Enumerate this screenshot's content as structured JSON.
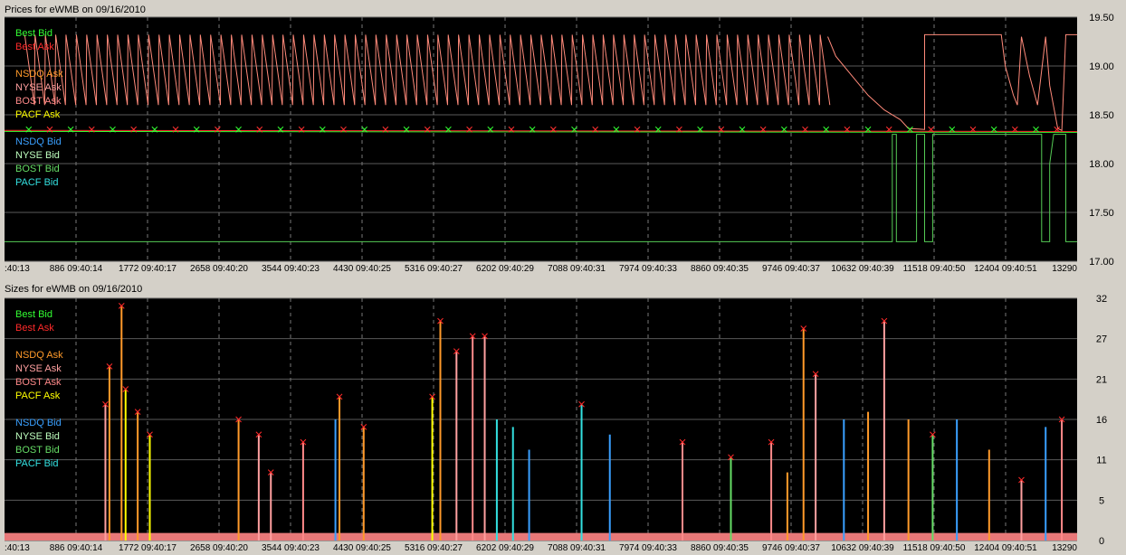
{
  "chart_data": [
    {
      "type": "line",
      "title": "Prices for  eWMB  on  09/16/2010",
      "ylim": [
        17.0,
        19.5
      ],
      "y_ticks": [
        "19.50",
        "19.00",
        "18.50",
        "18.00",
        "17.50",
        "17.00"
      ],
      "x_ticks": [
        ":40:13",
        "886 09:40:14",
        "1772 09:40:17",
        "2658 09:40:20",
        "3544 09:40:23",
        "4430 09:40:25",
        "5316 09:40:27",
        "6202 09:40:29",
        "7088 09:40:31",
        "7974 09:40:33",
        "8860 09:40:35",
        "9746 09:40:37",
        "10632 09:40:39",
        "11518 09:40:50",
        "12404 09:40:51",
        "13290"
      ],
      "x_range": [
        0,
        13290
      ],
      "grid": true,
      "legend": [
        {
          "label": "Best Bid",
          "color": "#33ff33"
        },
        {
          "label": "Best Ask",
          "color": "#ff2a2a"
        },
        {
          "label": "",
          "color": ""
        },
        {
          "label": "NSDQ Ask",
          "color": "#ff9a2a"
        },
        {
          "label": "NYSE Ask",
          "color": "#ffa0a0"
        },
        {
          "label": "BOST Ask",
          "color": "#ff8a8a"
        },
        {
          "label": "PACF Ask",
          "color": "#ffff00"
        },
        {
          "label": "",
          "color": ""
        },
        {
          "label": "NSDQ Bid",
          "color": "#3aa0ff"
        },
        {
          "label": "NYSE Bid",
          "color": "#bfffbf"
        },
        {
          "label": "BOST Bid",
          "color": "#66dd66"
        },
        {
          "label": "PACF Bid",
          "color": "#33e0e0"
        }
      ],
      "series": [
        {
          "name": "Best Bid",
          "color": "#33ff33",
          "values": [
            [
              0,
              18.33
            ],
            [
              13290,
              18.32
            ]
          ]
        },
        {
          "name": "Best Ask",
          "color": "#ff2a2a",
          "values": [
            [
              0,
              18.34
            ],
            [
              13290,
              18.33
            ]
          ]
        },
        {
          "name": "NYSE Ask",
          "color": "#ff8a7a",
          "sawtooth": {
            "x_start": 250,
            "x_end": 10200,
            "period": 128,
            "high": 19.32,
            "low": 18.6
          }
        },
        {
          "name": "NYSE Ask",
          "color": "#ff8a7a",
          "values": [
            [
              10200,
              19.3
            ],
            [
              10300,
              19.1
            ],
            [
              10500,
              18.9
            ],
            [
              10700,
              18.7
            ],
            [
              10900,
              18.55
            ],
            [
              11100,
              18.45
            ],
            [
              11200,
              18.36
            ],
            [
              11400,
              18.35
            ],
            [
              11400,
              19.32
            ],
            [
              12350,
              19.32
            ],
            [
              12400,
              19.0
            ],
            [
              12500,
              18.7
            ],
            [
              12550,
              18.6
            ],
            [
              12600,
              19.3
            ],
            [
              12700,
              18.9
            ],
            [
              12800,
              18.6
            ],
            [
              12900,
              19.3
            ],
            [
              12950,
              18.8
            ],
            [
              13050,
              18.36
            ],
            [
              13100,
              18.34
            ],
            [
              13150,
              19.32
            ],
            [
              13290,
              19.32
            ]
          ]
        },
        {
          "name": "BOST Bid",
          "color": "#55cc55",
          "values": [
            [
              0,
              17.2
            ],
            [
              11000,
              17.2
            ],
            [
              11000,
              18.3
            ],
            [
              11050,
              18.3
            ],
            [
              11050,
              17.2
            ],
            [
              11300,
              17.2
            ],
            [
              11300,
              18.3
            ],
            [
              11400,
              18.3
            ],
            [
              11400,
              17.2
            ],
            [
              11500,
              17.2
            ],
            [
              11500,
              18.3
            ],
            [
              12850,
              18.3
            ],
            [
              12850,
              17.2
            ],
            [
              12950,
              17.2
            ],
            [
              12950,
              18.0
            ],
            [
              13000,
              18.3
            ],
            [
              13150,
              18.3
            ],
            [
              13150,
              17.2
            ],
            [
              13290,
              17.2
            ]
          ]
        }
      ]
    },
    {
      "type": "bar",
      "title": "Sizes for  eWMB  on  09/16/2010",
      "ylim": [
        0,
        32
      ],
      "y_ticks": [
        "32",
        "27",
        "21",
        "16",
        "11",
        "5",
        "0"
      ],
      "x_ticks": [
        ":40:13",
        "886 09:40:14",
        "1772 09:40:17",
        "2658 09:40:20",
        "3544 09:40:23",
        "4430 09:40:25",
        "5316 09:40:27",
        "6202 09:40:29",
        "7088 09:40:31",
        "7974 09:40:33",
        "8860 09:40:35",
        "9746 09:40:37",
        "10632 09:40:39",
        "11518 09:40:50",
        "12404 09:40:51",
        "13290"
      ],
      "x_range": [
        0,
        13290
      ],
      "grid": true,
      "legend": [
        {
          "label": "Best Bid",
          "color": "#33ff33"
        },
        {
          "label": "Best Ask",
          "color": "#ff2a2a"
        },
        {
          "label": "",
          "color": ""
        },
        {
          "label": "NSDQ Ask",
          "color": "#ff9a2a"
        },
        {
          "label": "NYSE Ask",
          "color": "#ffa0a0"
        },
        {
          "label": "BOST Ask",
          "color": "#ff8a8a"
        },
        {
          "label": "PACF Ask",
          "color": "#ffff00"
        },
        {
          "label": "",
          "color": ""
        },
        {
          "label": "NSDQ Bid",
          "color": "#3aa0ff"
        },
        {
          "label": "NYSE Bid",
          "color": "#bfffbf"
        },
        {
          "label": "BOST Bid",
          "color": "#66dd66"
        },
        {
          "label": "PACF Bid",
          "color": "#33e0e0"
        }
      ],
      "baseline_band": {
        "value": 1,
        "color": "#e87878"
      },
      "spikes": [
        {
          "x": 1250,
          "y": 18,
          "color": "#ffa0a0",
          "marker": "x"
        },
        {
          "x": 1300,
          "y": 23,
          "color": "#ff9a2a",
          "marker": "x"
        },
        {
          "x": 1450,
          "y": 31,
          "color": "#ff9a2a",
          "marker": "x"
        },
        {
          "x": 1500,
          "y": 20,
          "color": "#ffff00",
          "marker": "x"
        },
        {
          "x": 1650,
          "y": 17,
          "color": "#ff9a2a",
          "marker": "x"
        },
        {
          "x": 1800,
          "y": 14,
          "color": "#ffff00",
          "marker": "x"
        },
        {
          "x": 2900,
          "y": 16,
          "color": "#ff9a2a",
          "marker": "x"
        },
        {
          "x": 3150,
          "y": 14,
          "color": "#ffa0a0",
          "marker": "x"
        },
        {
          "x": 3300,
          "y": 9,
          "color": "#ffa0a0",
          "marker": "x"
        },
        {
          "x": 3700,
          "y": 13,
          "color": "#ff8a8a",
          "marker": "x"
        },
        {
          "x": 4100,
          "y": 16,
          "color": "#3aa0ff",
          "marker": ""
        },
        {
          "x": 4150,
          "y": 19,
          "color": "#ff9a2a",
          "marker": "x"
        },
        {
          "x": 4450,
          "y": 15,
          "color": "#ff9a2a",
          "marker": "x"
        },
        {
          "x": 5300,
          "y": 19,
          "color": "#ffff00",
          "marker": "x"
        },
        {
          "x": 5400,
          "y": 29,
          "color": "#ff9a2a",
          "marker": "x"
        },
        {
          "x": 5600,
          "y": 25,
          "color": "#ffa0a0",
          "marker": "x"
        },
        {
          "x": 5800,
          "y": 27,
          "color": "#ff8a8a",
          "marker": "x"
        },
        {
          "x": 5950,
          "y": 27,
          "color": "#ffa0a0",
          "marker": "x"
        },
        {
          "x": 6100,
          "y": 16,
          "color": "#33e0e0",
          "marker": ""
        },
        {
          "x": 6300,
          "y": 15,
          "color": "#33e0e0",
          "marker": ""
        },
        {
          "x": 6500,
          "y": 12,
          "color": "#3aa0ff",
          "marker": ""
        },
        {
          "x": 7150,
          "y": 18,
          "color": "#33e0e0",
          "marker": "x"
        },
        {
          "x": 7500,
          "y": 14,
          "color": "#3aa0ff",
          "marker": ""
        },
        {
          "x": 8400,
          "y": 13,
          "color": "#ff8a8a",
          "marker": "x"
        },
        {
          "x": 9000,
          "y": 11,
          "color": "#66dd66",
          "marker": "x"
        },
        {
          "x": 9500,
          "y": 13,
          "color": "#ff8a8a",
          "marker": "x"
        },
        {
          "x": 9700,
          "y": 9,
          "color": "#ff9a2a",
          "marker": ""
        },
        {
          "x": 9900,
          "y": 28,
          "color": "#ff9a2a",
          "marker": "x"
        },
        {
          "x": 10050,
          "y": 22,
          "color": "#ffa0a0",
          "marker": "x"
        },
        {
          "x": 10400,
          "y": 16,
          "color": "#3aa0ff",
          "marker": ""
        },
        {
          "x": 10700,
          "y": 17,
          "color": "#ff9a2a",
          "marker": ""
        },
        {
          "x": 10900,
          "y": 29,
          "color": "#ffa0a0",
          "marker": "x"
        },
        {
          "x": 11200,
          "y": 16,
          "color": "#ff9a2a",
          "marker": ""
        },
        {
          "x": 11500,
          "y": 14,
          "color": "#66dd66",
          "marker": "x"
        },
        {
          "x": 11800,
          "y": 16,
          "color": "#3aa0ff",
          "marker": ""
        },
        {
          "x": 12200,
          "y": 12,
          "color": "#ff9a2a",
          "marker": ""
        },
        {
          "x": 12600,
          "y": 8,
          "color": "#ffa0a0",
          "marker": "x"
        },
        {
          "x": 12900,
          "y": 15,
          "color": "#3aa0ff",
          "marker": ""
        },
        {
          "x": 13100,
          "y": 16,
          "color": "#ff8a8a",
          "marker": "x"
        }
      ]
    }
  ]
}
